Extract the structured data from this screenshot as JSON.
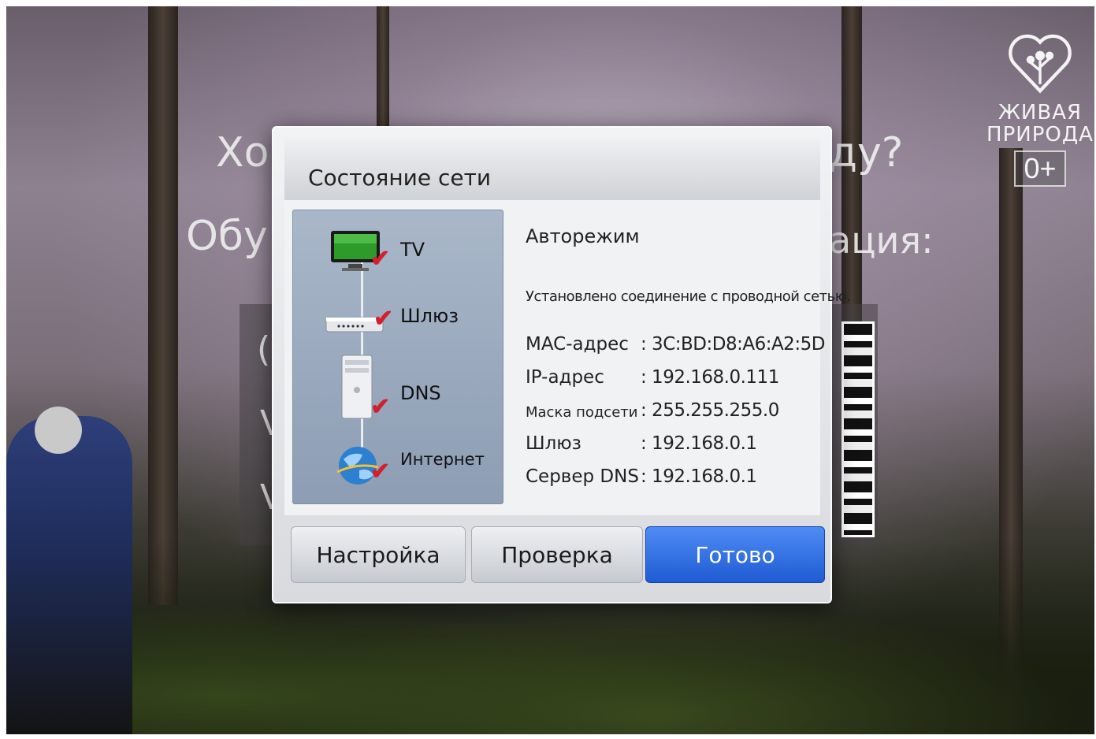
{
  "background": {
    "line1_fragment_left": "Хо",
    "line1_fragment_right": "ду?",
    "line2_fragment_left": "Обу",
    "line2_fragment_right": "ация:",
    "panel_fragment_1": "(",
    "panel_fragment_2": "V",
    "panel_fragment_3": "V"
  },
  "channel_logo": {
    "line1": "ЖИВАЯ",
    "line2": "ПРИРОДА",
    "age_rating": "0+"
  },
  "dialog": {
    "title": "Состояние сети",
    "diagram": {
      "tv_label": "TV",
      "gateway_label": "Шлюз",
      "dns_label": "DNS",
      "internet_label": "Интернет"
    },
    "mode": "Авторежим",
    "status": "Установлено соединение с проводной сетью.",
    "rows": [
      {
        "key": "MAC-адрес",
        "value": ": 3C:BD:D8:A6:A2:5D"
      },
      {
        "key": "IP-адрес",
        "value": ": 192.168.0.111"
      },
      {
        "key": "Маска подсети",
        "value": ": 255.255.255.0"
      },
      {
        "key": "Шлюз",
        "value": ": 192.168.0.1"
      },
      {
        "key": "Сервер DNS",
        "value": ": 192.168.0.1"
      }
    ],
    "buttons": {
      "settings": "Настройка",
      "test": "Проверка",
      "done": "Готово"
    }
  },
  "colors": {
    "primary_button": "#2d6be0",
    "check_mark": "#d32030",
    "tv_screen": "#2e9a2a"
  }
}
